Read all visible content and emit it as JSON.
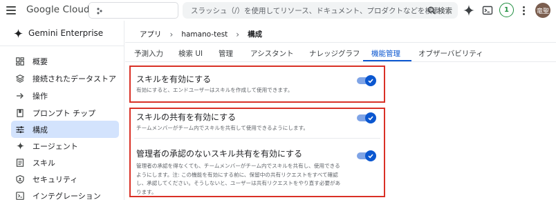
{
  "topbar": {
    "brand": "Google Cloud",
    "search_placeholder": "スラッシュ（/）を使用してリソース、ドキュメント、プロダクトなどを検索",
    "search_button": "検索",
    "notifications_count": "1",
    "avatar_initials": "竜聖"
  },
  "sidebar": {
    "title": "Gemini Enterprise",
    "items": [
      {
        "label": "概要",
        "icon": "dashboard-icon"
      },
      {
        "label": "接続されたデータストア",
        "icon": "data-store-icon"
      },
      {
        "label": "操作",
        "icon": "arrow-right-icon"
      },
      {
        "label": "プロンプト チップ",
        "icon": "bookmark-icon"
      },
      {
        "label": "構成",
        "icon": "tune-icon",
        "active": true
      },
      {
        "label": "エージェント",
        "icon": "sparkle-icon"
      },
      {
        "label": "スキル",
        "icon": "document-icon"
      },
      {
        "label": "セキュリティ",
        "icon": "shield-icon"
      },
      {
        "label": "インテグレーション",
        "icon": "integration-icon"
      }
    ]
  },
  "breadcrumb": [
    "アプリ",
    "hamano-test",
    "構成"
  ],
  "tabs": [
    {
      "label": "予測入力"
    },
    {
      "label": "検索 UI"
    },
    {
      "label": "管理"
    },
    {
      "label": "アシスタント"
    },
    {
      "label": "ナレッジグラフ"
    },
    {
      "label": "機能管理",
      "active": true
    },
    {
      "label": "オブザーバビリティ"
    }
  ],
  "settings": {
    "enable_skills": {
      "title": "スキルを有効にする",
      "description": "有効にすると、エンドユーザーはスキルを作成して使用できます。",
      "enabled": true
    },
    "enable_sharing": {
      "title": "スキルの共有を有効にする",
      "description": "チームメンバーがチーム内でスキルを共有して使用できるようにします。",
      "enabled": true
    },
    "enable_unapproved_sharing": {
      "title": "管理者の承認のないスキル共有を有効にする",
      "description_lines": [
        "管理者の承認を得なくても、チームメンバーがチーム内でスキルを共有し、使用できる",
        "ようにします。注: この機能を有効にする前に、保留中の共有リクエストをすべて確認",
        "し、承認してください。そうしないと、ユーザーは共有リクエストをやり直す必要があ",
        "ります。"
      ],
      "enabled": true
    }
  },
  "colors": {
    "accent": "#0b57d0",
    "active_nav_bg": "#d3e3fd",
    "highlight_border": "#d93025",
    "toggle_track": "#7fa4e6"
  }
}
